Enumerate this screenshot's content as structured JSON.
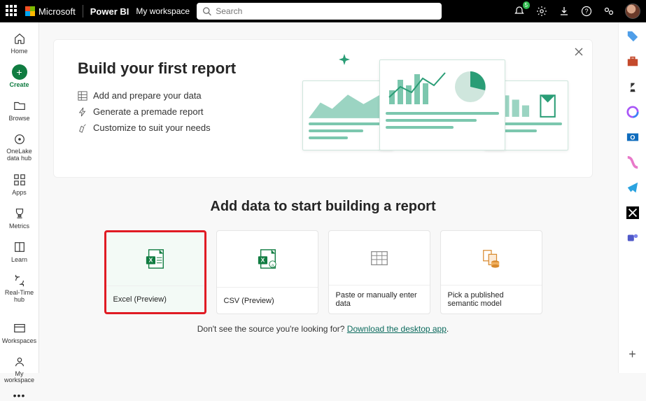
{
  "topbar": {
    "ms_label": "Microsoft",
    "brand": "Power BI",
    "workspace": "My workspace",
    "search_placeholder": "Search",
    "notification_count": "5"
  },
  "leftnav": {
    "home": "Home",
    "create": "Create",
    "browse": "Browse",
    "onelake": "OneLake\ndata hub",
    "apps": "Apps",
    "metrics": "Metrics",
    "learn": "Learn",
    "realtime": "Real-Time\nhub",
    "workspaces": "Workspaces",
    "myworkspace": "My\nworkspace"
  },
  "hero": {
    "title": "Build your first report",
    "bullets": [
      "Add and prepare your data",
      "Generate a premade report",
      "Customize to suit your needs"
    ]
  },
  "section_title": "Add data to start building a report",
  "cards": [
    {
      "label": "Excel (Preview)"
    },
    {
      "label": "CSV (Preview)"
    },
    {
      "label": "Paste or manually enter data"
    },
    {
      "label": "Pick a published semantic model"
    }
  ],
  "footer": {
    "prefix": "Don't see the source you're looking for? ",
    "link": "Download the desktop app",
    "suffix": "."
  }
}
